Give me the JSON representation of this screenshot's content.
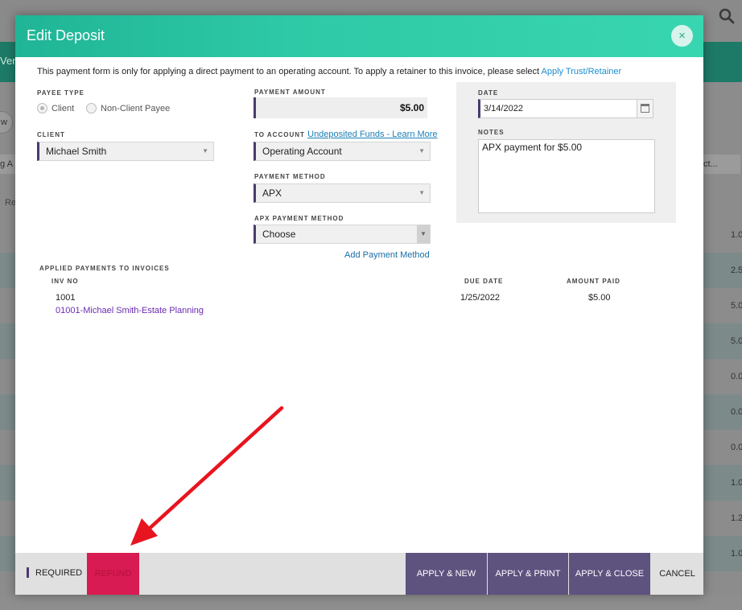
{
  "background": {
    "teal_text": "Vend",
    "pill_text": "w",
    "col_left": "g A",
    "col_right": "ct...",
    "left_text": "Re",
    "row_values": [
      "1.0",
      "2.5",
      "5.0",
      "5.0",
      "0.0",
      "0.0",
      "0.0",
      "1.0",
      "1.2",
      "1.0"
    ]
  },
  "modal": {
    "title": "Edit Deposit",
    "close_symbol": "×",
    "notice": "This payment form is only for applying a direct payment to an operating account. To apply a retainer to this invoice, please select ",
    "notice_link": "Apply Trust/Retainer",
    "payee_type": {
      "label": "PAYEE TYPE",
      "options": [
        "Client",
        "Non-Client Payee"
      ],
      "selected": "Client"
    },
    "client": {
      "label": "CLIENT",
      "value": "Michael Smith"
    },
    "payment_amount": {
      "label": "PAYMENT AMOUNT",
      "value": "$5.00"
    },
    "to_account": {
      "label": "TO ACCOUNT",
      "link": "Undeposited Funds - Learn More",
      "value": "Operating Account"
    },
    "payment_method": {
      "label": "PAYMENT METHOD",
      "value": "APX"
    },
    "apx_payment_method": {
      "label": "APX PAYMENT METHOD",
      "value": "Choose"
    },
    "add_payment_method": "Add Payment Method",
    "date": {
      "label": "DATE",
      "value": "3/14/2022"
    },
    "notes": {
      "label": "NOTES",
      "value": "APX payment for $5.00"
    },
    "applied": {
      "label": "APPLIED PAYMENTS TO INVOICES",
      "headers": {
        "inv_no": "INV NO",
        "due_date": "DUE DATE",
        "amount_paid": "AMOUNT PAID"
      },
      "rows": [
        {
          "inv_no": "1001",
          "matter": "01001-Michael Smith-Estate Planning",
          "due_date": "1/25/2022",
          "amount_paid": "$5.00"
        }
      ]
    },
    "footer": {
      "required": "REQUIRED",
      "refund": "REFUND",
      "apply_new": "APPLY & NEW",
      "apply_print": "APPLY & PRINT",
      "apply_close": "APPLY & CLOSE",
      "cancel": "CANCEL"
    }
  },
  "colors": {
    "header_teal": "#2ec9a6",
    "accent_purple": "#5e527f",
    "refund_red": "#d81b52",
    "link_blue": "#1a8fd1",
    "arrow_red": "#e8141f"
  }
}
